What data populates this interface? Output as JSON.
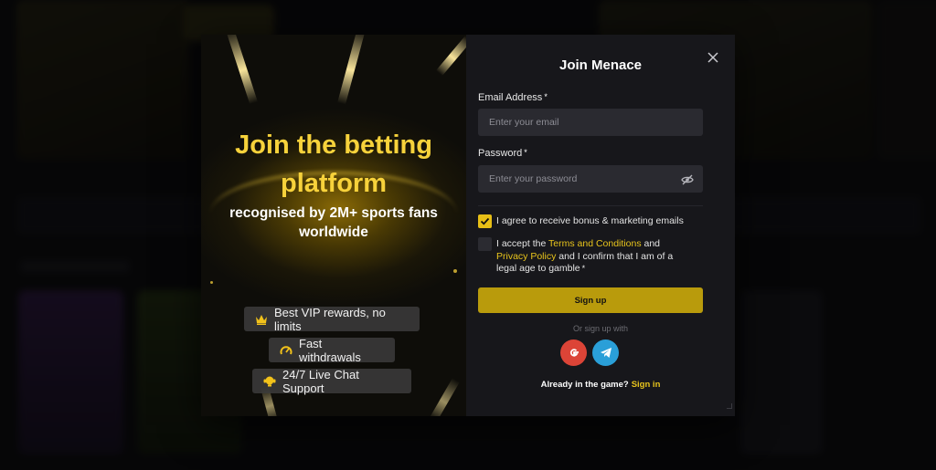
{
  "promo": {
    "title_line1": "Join the betting",
    "title_line2": "platform",
    "subtitle_line1": "recognised by 2M+ sports fans",
    "subtitle_line2": "worldwide",
    "features": [
      {
        "icon": "crown-icon",
        "label": "Best VIP rewards, no limits"
      },
      {
        "icon": "speedometer-icon",
        "label": "Fast withdrawals"
      },
      {
        "icon": "support-icon",
        "label": "24/7 Live Chat Support"
      }
    ]
  },
  "form": {
    "title": "Join Menace",
    "email_label": "Email Address",
    "email_placeholder": "Enter your email",
    "password_label": "Password",
    "password_placeholder": "Enter your password",
    "required_mark": "*",
    "bonus_consent": {
      "checked": true,
      "text": "I agree to receive bonus & marketing emails"
    },
    "terms_consent": {
      "checked": false,
      "prefix": "I accept the ",
      "terms_link": "Terms and Conditions",
      "middle": " and",
      "privacy_link": "Privacy Policy",
      "suffix_line2": " and I confirm that I am of a",
      "suffix_line3": "legal age to gamble"
    },
    "signup_button": "Sign up",
    "or_text": "Or sign up with",
    "social": [
      {
        "icon": "google-icon",
        "color": "#dc4437"
      },
      {
        "icon": "telegram-icon",
        "color": "#2a9fd8"
      }
    ],
    "already_text": "Already in the game?",
    "signin_link": "Sign in"
  },
  "colors": {
    "accent": "#f7d23b",
    "button": "#b99b0c",
    "panel": "#17171b",
    "input": "#2a2a30"
  }
}
